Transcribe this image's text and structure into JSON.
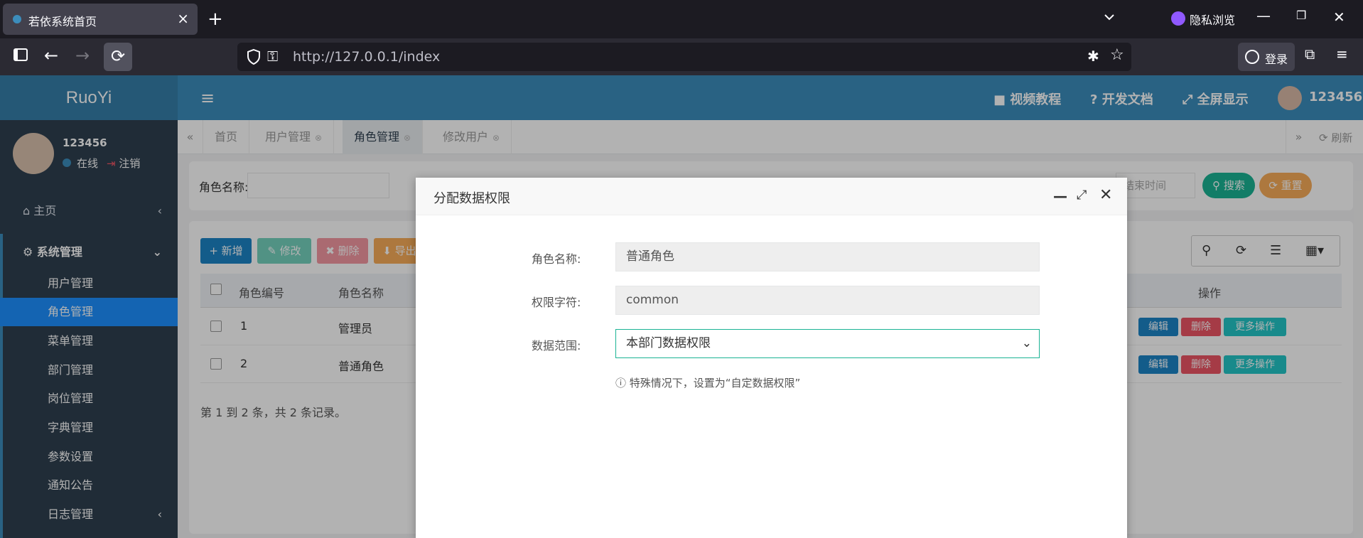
{
  "browser": {
    "tab_title": "若依系统首页",
    "new_tab": "+",
    "private_label": "隐私浏览",
    "url": "http://127.0.0.1/index",
    "login": "登录"
  },
  "app": {
    "logo": "RuoYi",
    "top": {
      "video": "视频教程",
      "docs": "开发文档",
      "fullscreen": "全屏显示",
      "user": "123456"
    },
    "userpanel": {
      "name": "123456",
      "online": "在线",
      "logout": "注销"
    },
    "menu": {
      "home": "主页",
      "system": "系统管理",
      "sub": [
        "用户管理",
        "角色管理",
        "菜单管理",
        "部门管理",
        "岗位管理",
        "字典管理",
        "参数设置",
        "通知公告",
        "日志管理"
      ]
    },
    "tabs": [
      {
        "label": "首页"
      },
      {
        "label": "用户管理"
      },
      {
        "label": "角色管理"
      },
      {
        "label": "修改用户"
      }
    ],
    "refresh": "刷新",
    "search": {
      "role_name_label": "角色名称:",
      "end_time_placeholder": "结束时间",
      "search_btn": "搜索",
      "reset_btn": "重置"
    },
    "toolbar": {
      "add": "新增",
      "edit": "修改",
      "delete": "删除",
      "export": "导出"
    },
    "table": {
      "headers": [
        "角色编号",
        "角色名称",
        "操作"
      ],
      "rows": [
        {
          "id": "1",
          "name": "管理员"
        },
        {
          "id": "2",
          "name": "普通角色"
        }
      ],
      "row_actions": {
        "edit": "编辑",
        "delete": "删除",
        "more": "更多操作"
      }
    },
    "pagination": "第 1 到 2 条，共 2 条记录。"
  },
  "modal": {
    "title": "分配数据权限",
    "role_name_label": "角色名称:",
    "role_name_value": "普通角色",
    "perm_label": "权限字符:",
    "perm_value": "common",
    "scope_label": "数据范围:",
    "scope_value": "本部门数据权限",
    "hint": "特殊情况下，设置为“自定数据权限”"
  },
  "colors": {
    "primary": "#3c8dbc",
    "sidebar": "#2f4050",
    "active_menu": "#1e90ff",
    "success": "#1ab394",
    "warning": "#f8ac59",
    "danger": "#ed5565",
    "info": "#23c6c8",
    "blue_btn": "#1c84c6"
  }
}
